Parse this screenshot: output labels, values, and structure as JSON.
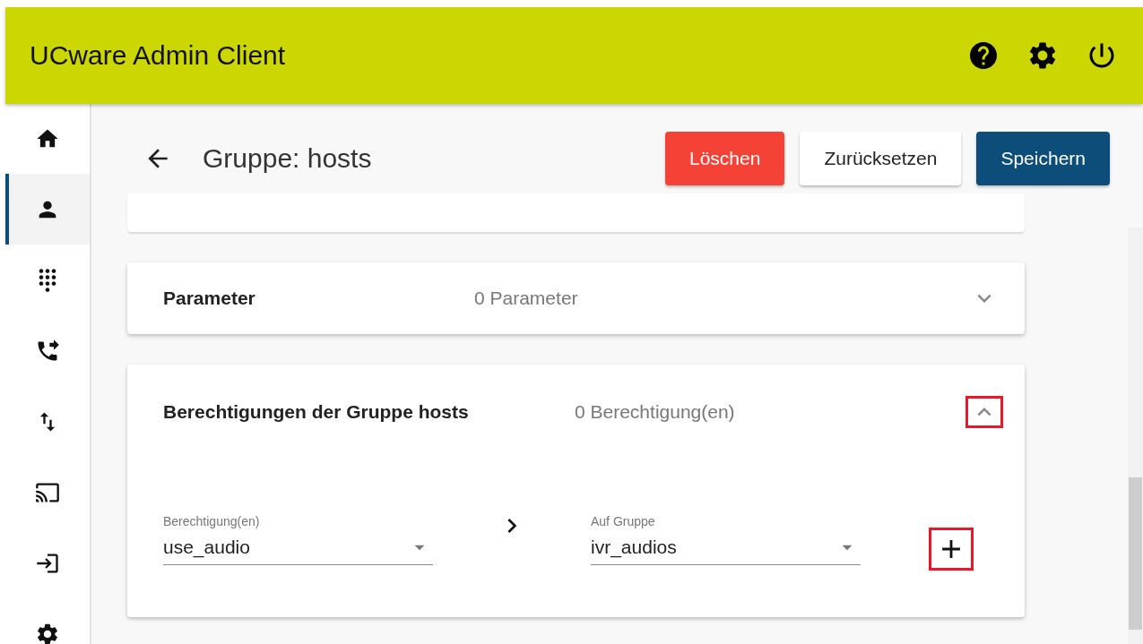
{
  "header": {
    "title": "UCware Admin Client"
  },
  "sidebar": {
    "items": [
      {
        "selected": false
      },
      {
        "selected": true
      },
      {
        "selected": false
      },
      {
        "selected": false
      },
      {
        "selected": false
      },
      {
        "selected": false
      },
      {
        "selected": false
      },
      {
        "selected": false
      }
    ]
  },
  "page": {
    "title": "Gruppe: hosts",
    "buttons": [
      {
        "label": "Löschen",
        "kind": "danger"
      },
      {
        "label": "Zurücksetzen",
        "kind": "plain"
      },
      {
        "label": "Speichern",
        "kind": "primary"
      }
    ]
  },
  "cards": [
    {
      "title": "Parameter",
      "summary": "0 Parameter",
      "expanded": false,
      "highlighted": false
    },
    {
      "title": "Berechtigungen der Gruppe hosts",
      "summary": "0 Berechtigung(en)",
      "expanded": true,
      "highlighted": true,
      "fields": [
        {
          "label": "Berechtigung(en)",
          "value": "use_audio"
        },
        {
          "label": "Auf Gruppe",
          "value": "ivr_audios"
        }
      ],
      "add_button": {
        "highlighted": true
      }
    }
  ]
}
